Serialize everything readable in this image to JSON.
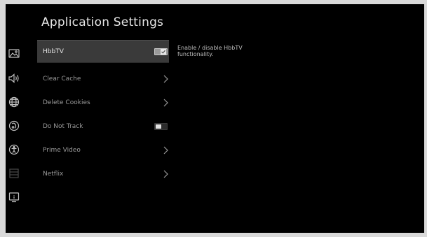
{
  "page": {
    "title": "Application Settings"
  },
  "sidebar": {
    "icons": [
      {
        "name": "picture-icon"
      },
      {
        "name": "sound-icon"
      },
      {
        "name": "globe-icon"
      },
      {
        "name": "accessibility-icon"
      },
      {
        "name": "person-accessibility-icon"
      },
      {
        "name": "list-icon"
      },
      {
        "name": "info-screen-icon"
      }
    ]
  },
  "menu": {
    "items": [
      {
        "label": "HbbTV",
        "control": "toggle",
        "state": "on",
        "selected": true
      },
      {
        "label": "Clear Cache",
        "control": "chevron",
        "selected": false
      },
      {
        "label": "Delete Cookies",
        "control": "chevron",
        "selected": false
      },
      {
        "label": "Do Not Track",
        "control": "toggle",
        "state": "off",
        "selected": false
      },
      {
        "label": "Prime Video",
        "control": "chevron",
        "selected": false
      },
      {
        "label": "Netflix",
        "control": "chevron",
        "selected": false
      }
    ]
  },
  "description": {
    "text": "Enable / disable HbbTV functionality."
  },
  "colors": {
    "background": "#000000",
    "selected_row": "#3a3a3a",
    "text_primary": "#e8e8e8",
    "text_secondary": "#9a9a9a"
  }
}
